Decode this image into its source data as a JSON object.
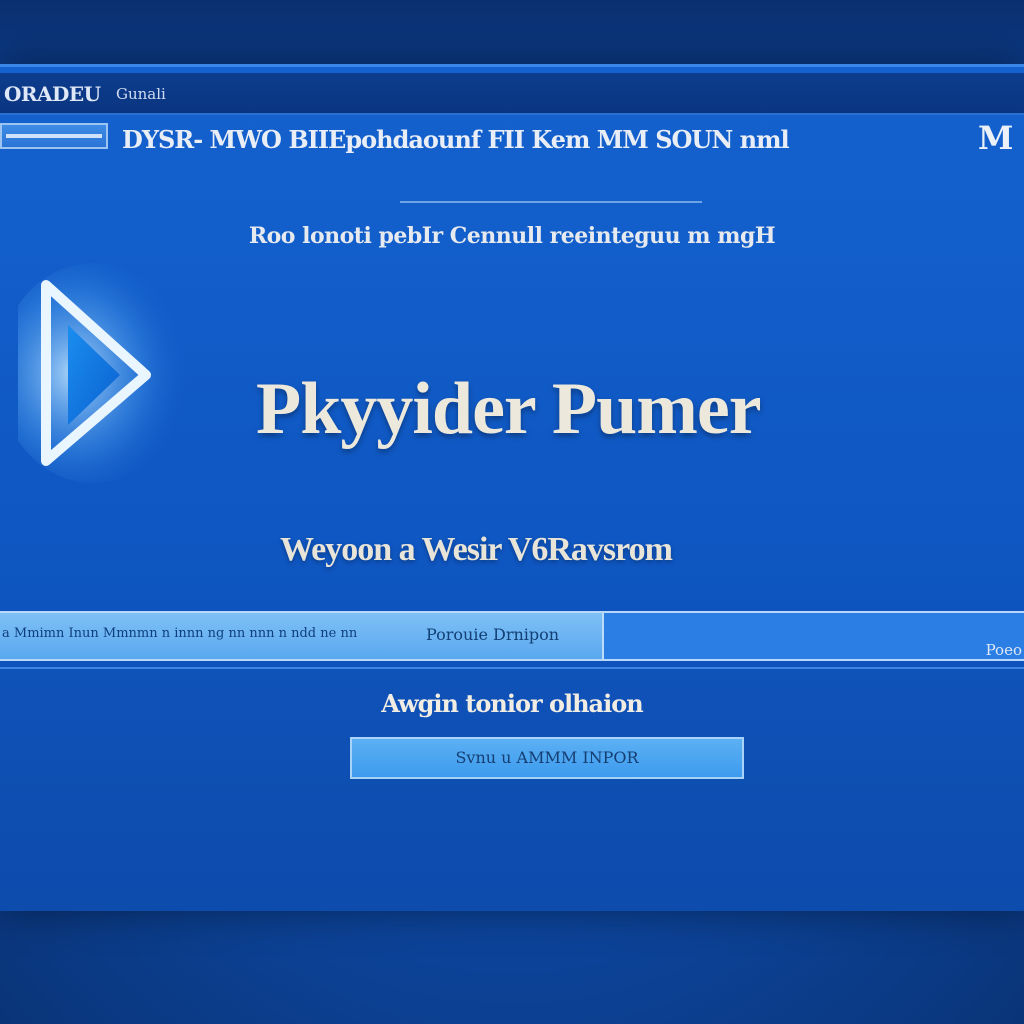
{
  "window": {
    "title": "ORADEU",
    "title_sub": "Gunali",
    "menu_text": "DYSR- MWO BIIEpohdaounf FII Kem MM SOUN nml",
    "menu_mark": "M"
  },
  "content": {
    "subtitle": "Roo lonoti pebIr Cennull reeinteguu m mgH",
    "app_name": "Pkyyider Pumer",
    "tagline": "Weyoon  a Wesir V6Ravsrom",
    "logo_icon": "play-triangle-icon"
  },
  "status": {
    "left_text": "a Mmimn Inun Mmnmn n innn ng nn nnn n ndd ne nn",
    "mid_text": "Porouie Drnipon",
    "right_text": "Poeo",
    "progress": 0.59
  },
  "footer": {
    "info_label": "Awgin tonior olhaion",
    "button_label": "Svnu u AMMM INPOR"
  },
  "colors": {
    "accent": "#1462cf",
    "progress_fill": "#6db7f4",
    "logo_glow": "#bfe4ff"
  }
}
